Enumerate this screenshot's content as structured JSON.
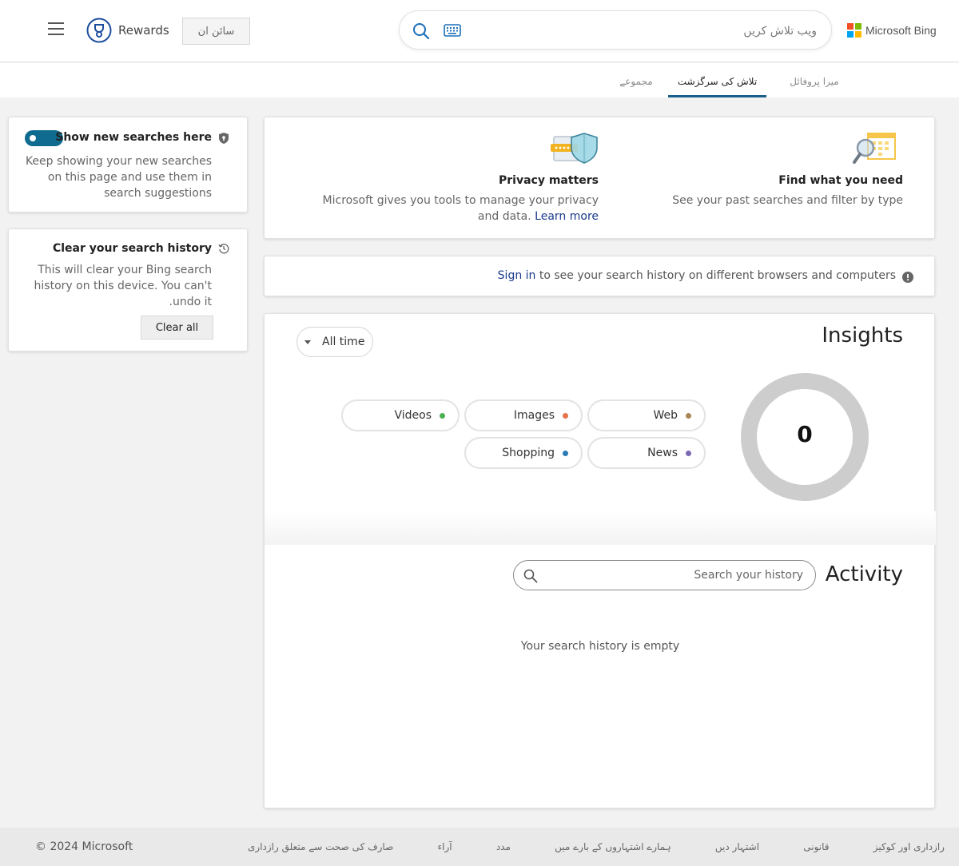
{
  "header": {
    "rewards_label": "Rewards",
    "signin_label": "سائن ان",
    "search_placeholder": "ویب تلاش کریں",
    "brand": "Microsoft Bing",
    "logo_colors": [
      "#f25022",
      "#7fba00",
      "#00a4ef",
      "#ffb900"
    ]
  },
  "tabs": [
    {
      "label": "میرا پروفائل",
      "active": false
    },
    {
      "label": "تلاش کی سرگزشت",
      "active": true
    },
    {
      "label": "مجموعے",
      "active": false
    }
  ],
  "sidebar": {
    "toggle_card": {
      "title": "Show new searches here",
      "text": "Keep showing your new searches on this page and use them in search suggestions",
      "toggle_on": true
    },
    "clear_card": {
      "title": "Clear your search history",
      "text": "This will clear your Bing search history on this device. You can't undo it.",
      "button": "Clear all"
    }
  },
  "features": {
    "find": {
      "title": "Find what you need",
      "text": "See your past searches and filter by type"
    },
    "privacy": {
      "title": "Privacy matters",
      "text": "Microsoft gives you tools to manage your privacy and data.",
      "link": "Learn more"
    }
  },
  "signin_banner": {
    "link": "Sign in",
    "text": "to see your search history on different browsers and computers"
  },
  "insights": {
    "title": "Insights",
    "time_filter": "All time",
    "total": "0",
    "categories": [
      {
        "label": "Web",
        "color": "#a98755"
      },
      {
        "label": "Images",
        "color": "#e5734a"
      },
      {
        "label": "Videos",
        "color": "#4caf50"
      },
      {
        "label": "News",
        "color": "#7b68b3"
      },
      {
        "label": "Shopping",
        "color": "#2a7ab5"
      }
    ]
  },
  "activity": {
    "title": "Activity",
    "search_placeholder": "Search your history",
    "empty_message": "Your search history is empty"
  },
  "footer": {
    "copyright": "© 2024 Microsoft",
    "links": [
      "رازداری اور کوکیز",
      "قانونی",
      "اشتہار دیں",
      "ہمارے اشتہاروں کے بارے میں",
      "مدد",
      "آراء",
      "صارف کی صحت سے متعلق رازداری"
    ]
  }
}
